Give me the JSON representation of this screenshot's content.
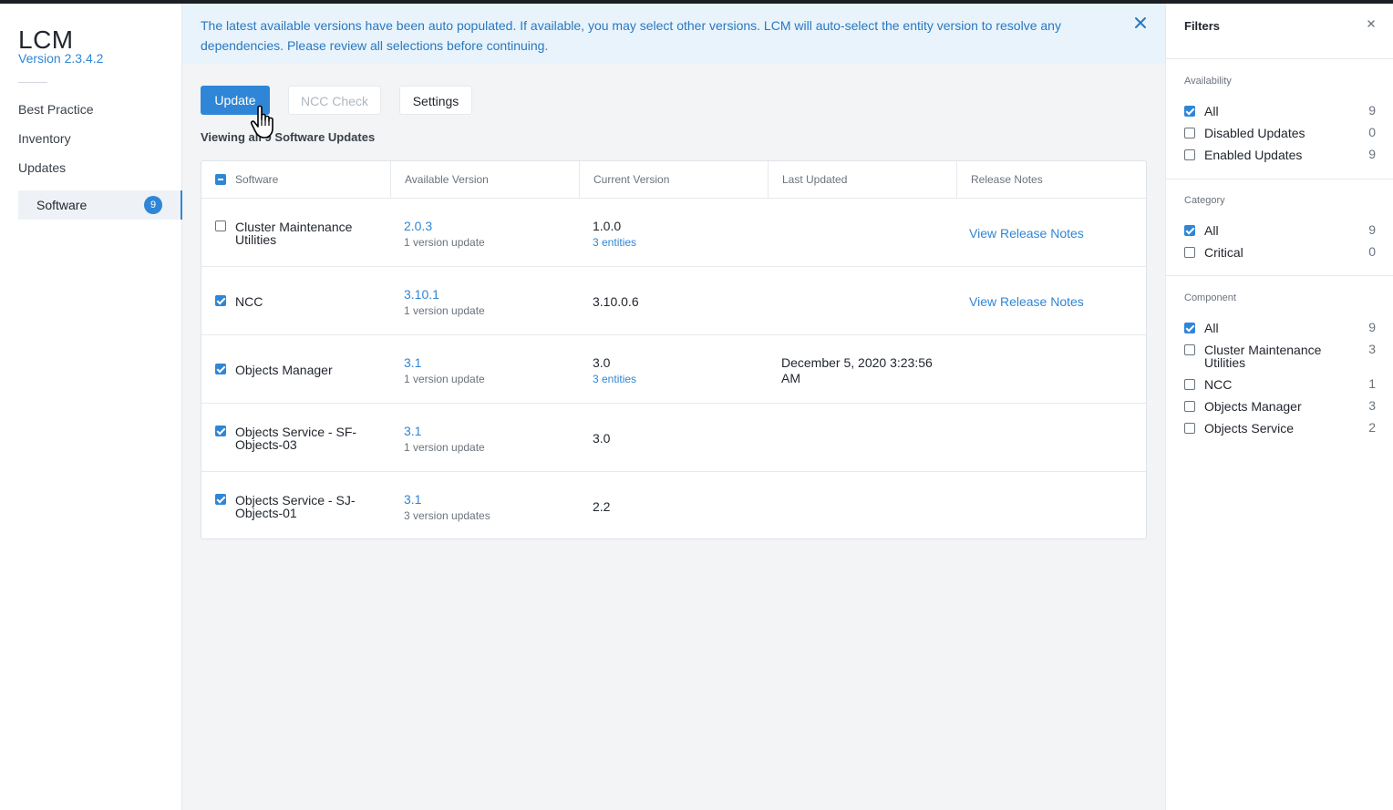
{
  "app": {
    "title": "LCM",
    "version": "Version 2.3.4.2"
  },
  "nav": {
    "items": [
      "Best Practice",
      "Inventory",
      "Updates"
    ],
    "sub_item": {
      "label": "Software",
      "badge": "9"
    }
  },
  "banner": {
    "text": "The latest available versions have been auto populated. If available, you may select other versions. LCM will auto-select the entity version to resolve any dependencies. Please review all selections before continuing.",
    "close_icon": "close-icon"
  },
  "toolbar": {
    "update_label": "Update",
    "ncc_check_label": "NCC Check",
    "settings_label": "Settings"
  },
  "view_label": "Viewing all 9 Software Updates",
  "table": {
    "headers": [
      "Software",
      "Available Version",
      "Current Version",
      "Last Updated",
      "Release Notes"
    ],
    "rows": [
      {
        "checked": false,
        "software": "Cluster Maintenance Utilities",
        "available": "2.0.3",
        "available_sub": "1 version update",
        "current": "1.0.0",
        "current_sub": "3 entities",
        "last_updated": "",
        "notes": "View Release Notes"
      },
      {
        "checked": true,
        "software": "NCC",
        "available": "3.10.1",
        "available_sub": "1 version update",
        "current": "3.10.0.6",
        "current_sub": "",
        "last_updated": "",
        "notes": "View Release Notes"
      },
      {
        "checked": true,
        "software": "Objects Manager",
        "available": "3.1",
        "available_sub": "1 version update",
        "current": "3.0",
        "current_sub": "3 entities",
        "last_updated": "December 5, 2020 3:23:56 AM",
        "notes": ""
      },
      {
        "checked": true,
        "software": "Objects Service - SF-Objects-03",
        "available": "3.1",
        "available_sub": "1 version update",
        "current": "3.0",
        "current_sub": "",
        "last_updated": "",
        "notes": ""
      },
      {
        "checked": true,
        "software": "Objects Service - SJ-Objects-01",
        "available": "3.1",
        "available_sub": "3 version updates",
        "current": "2.2",
        "current_sub": "",
        "last_updated": "",
        "notes": ""
      }
    ]
  },
  "filters": {
    "title": "Filters",
    "sections": [
      {
        "label": "Availability",
        "options": [
          {
            "label": "All",
            "count": "9",
            "checked": true
          },
          {
            "label": "Disabled Updates",
            "count": "0",
            "checked": false
          },
          {
            "label": "Enabled Updates",
            "count": "9",
            "checked": false
          }
        ]
      },
      {
        "label": "Category",
        "options": [
          {
            "label": "All",
            "count": "9",
            "checked": true
          },
          {
            "label": "Critical",
            "count": "0",
            "checked": false
          }
        ]
      },
      {
        "label": "Component",
        "options": [
          {
            "label": "All",
            "count": "9",
            "checked": true
          },
          {
            "label": "Cluster Maintenance Utilities",
            "count": "3",
            "checked": false
          },
          {
            "label": "NCC",
            "count": "1",
            "checked": false
          },
          {
            "label": "Objects Manager",
            "count": "3",
            "checked": false
          },
          {
            "label": "Objects Service",
            "count": "2",
            "checked": false
          }
        ]
      }
    ]
  },
  "colors": {
    "accent": "#2f86d6",
    "banner_bg": "#e8f3fb",
    "page_bg": "#f2f4f6"
  }
}
